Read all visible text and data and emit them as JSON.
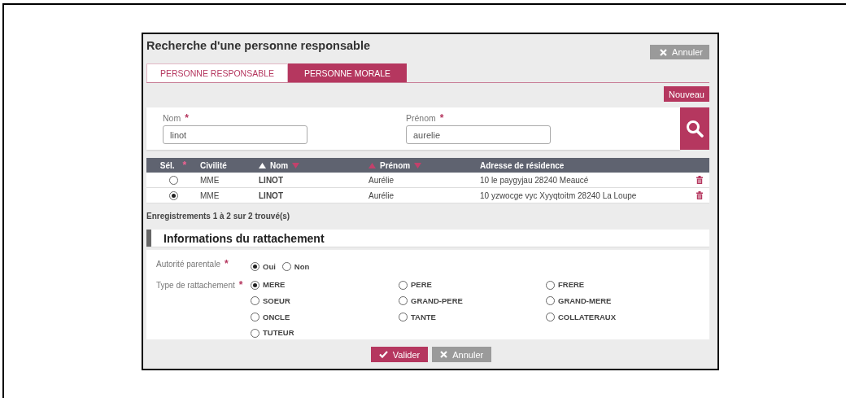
{
  "dialog": {
    "title": "Recherche d'une personne responsable",
    "cancel_button": "Annuler"
  },
  "tabs": [
    {
      "label": "PERSONNE RESPONSABLE",
      "selected": true
    },
    {
      "label": "PERSONNE MORALE",
      "selected": false
    }
  ],
  "new_button": "Nouveau",
  "search": {
    "fields": [
      {
        "label": "Nom",
        "required_mark": "*",
        "value": "linot"
      },
      {
        "label": "Prénom",
        "required_mark": "*",
        "value": "aurelie"
      }
    ]
  },
  "table": {
    "columns": [
      {
        "label": "Sél.",
        "required_mark": "*"
      },
      {
        "label": "Civilité"
      },
      {
        "label": "Nom",
        "sort_up_active": true,
        "sort_down_active": false
      },
      {
        "label": "Prénom",
        "sort_up_active": false,
        "sort_down_active": false
      },
      {
        "label": "Adresse de résidence"
      }
    ],
    "rows": [
      {
        "selected": false,
        "civilite": "MME",
        "nom": "LINOT",
        "prenom": "Aurélie",
        "adresse": "10 le paygyjau 28240 Meaucé"
      },
      {
        "selected": true,
        "civilite": "MME",
        "nom": "LINOT",
        "prenom": "Aurélie",
        "adresse": "10 yzwocge vyc Xyyqtoitm 28240 La Loupe"
      }
    ],
    "footer": "Enregistrements 1 à 2 sur 2 trouvé(s)"
  },
  "section": {
    "title": "Informations du rattachement",
    "authority": {
      "label": "Autorité parentale",
      "required_mark": "*",
      "options": [
        {
          "label": "Oui",
          "selected": true
        },
        {
          "label": "Non",
          "selected": false
        }
      ]
    },
    "type": {
      "label": "Type de rattachement",
      "required_mark": "*",
      "options": [
        {
          "label": "MERE",
          "selected": true
        },
        {
          "label": "PERE",
          "selected": false
        },
        {
          "label": "FRERE",
          "selected": false
        },
        {
          "label": "SOEUR",
          "selected": false
        },
        {
          "label": "GRAND-PERE",
          "selected": false
        },
        {
          "label": "GRAND-MERE",
          "selected": false
        },
        {
          "label": "ONCLE",
          "selected": false
        },
        {
          "label": "TANTE",
          "selected": false
        },
        {
          "label": "COLLATERAUX",
          "selected": false
        },
        {
          "label": "TUTEUR",
          "selected": false
        }
      ]
    }
  },
  "buttons": {
    "validate": "Valider",
    "cancel": "Annuler"
  }
}
